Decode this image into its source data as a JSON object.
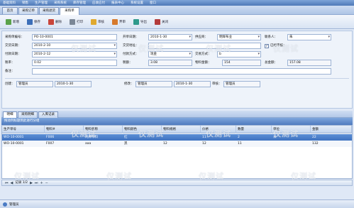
{
  "menu": [
    "基础资料",
    "销售",
    "生产管理",
    "采购系统",
    "库存管理",
    "应收应付",
    "报表中心",
    "系统设置",
    "窗口"
  ],
  "tabs": [
    "首页",
    "采购订单",
    "采购退货",
    "采购单"
  ],
  "toolbar": [
    "新增",
    "保存",
    "删除",
    "打印",
    "审核",
    "弃审",
    "导出",
    "关闭"
  ],
  "form": {
    "order_no_label": "采购单编号：",
    "order_no": "PO-10-0001",
    "order_date_label": "开单日期：",
    "order_date": "2010-1-30",
    "supplier_label": "供应商：",
    "supplier": "明辉布业",
    "contact_label": "联系人：",
    "contact": "朱",
    "delivery_date_label": "交货日期：",
    "delivery_date": "2010-2-10",
    "delivery_addr_label": "交货地址：",
    "delivery_addr": "",
    "audited_label": "已经审核：",
    "pay_date_label": "付款日期：",
    "pay_date": "2010-2-12",
    "pay_method_label": "付款方式：",
    "pay_method": "现金",
    "trade_method_label": "交易方式：",
    "trade_method": "b",
    "tax_rate_label": "税率：",
    "tax_rate": "0.02",
    "tax_amount_label": "税额：",
    "tax_amount": "3.08",
    "material_amount_label": "物料金额：",
    "material_amount": "154",
    "total_amount_label": "总金额：",
    "total_amount": "157.08",
    "remark_label": "备注：",
    "remark": "",
    "creator_label": "创建：",
    "creator": "管理员",
    "create_date": "2010-1-30",
    "modifier_label": "修改：",
    "modifier": "管理员",
    "modify_date": "2010-1-30",
    "auditor_label": "审核：",
    "auditor": "管理员"
  },
  "panel_tabs": [
    "明细",
    "采购明细",
    "入库记录"
  ],
  "group_hint": "拖动列标题到此进行分组",
  "grid": {
    "columns": [
      "生产单号",
      "物料#",
      "物料名称",
      "物料颜色",
      "物料规格",
      "价格",
      "数量",
      "单位",
      "金额"
    ],
    "rows": [
      [
        "WO-10-0001",
        "F006",
        "纯棉布料",
        "红",
        "",
        "11",
        "2",
        "米",
        "22"
      ],
      [
        "WO-10-0001",
        "F007",
        "aaa",
        "黑",
        "12",
        "12",
        "11",
        "",
        "132"
      ]
    ]
  },
  "pager": {
    "record": "记录 1/2"
  },
  "status": {
    "user": "管理员"
  },
  "watermark": "仅测试"
}
